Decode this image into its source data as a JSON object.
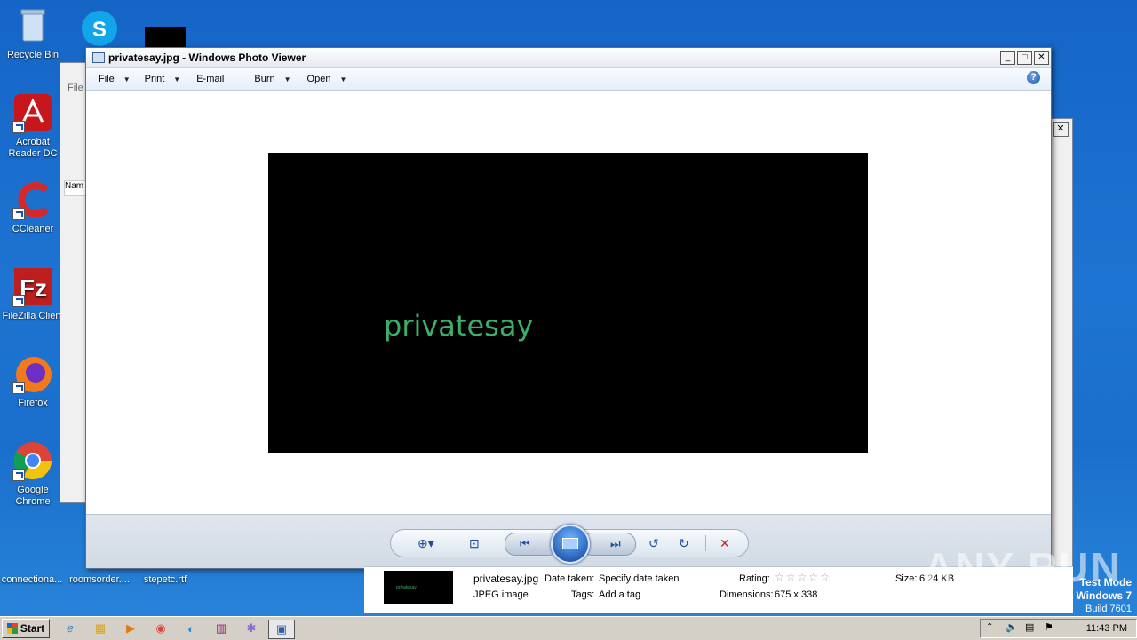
{
  "desktop": {
    "icons": [
      {
        "label": "Recycle Bin",
        "icon": "recycle-bin-icon"
      },
      {
        "label": "Acrobat Reader DC",
        "icon": "acrobat-icon"
      },
      {
        "label": "CCleaner",
        "icon": "ccleaner-icon"
      },
      {
        "label": "FileZilla Client",
        "icon": "filezilla-icon"
      },
      {
        "label": "Firefox",
        "icon": "firefox-icon"
      },
      {
        "label": "Google Chrome",
        "icon": "chrome-icon"
      }
    ],
    "files": [
      "connectiona...",
      "roomsorder....",
      "stepetc.rtf"
    ]
  },
  "viewer": {
    "title": "privatesay.jpg - Windows Photo Viewer",
    "menu": [
      {
        "label": "File",
        "caret": "▼"
      },
      {
        "label": "Print",
        "caret": "▼"
      },
      {
        "label": "E-mail",
        "caret": ""
      },
      {
        "label": "Burn",
        "caret": "▼"
      },
      {
        "label": "Open",
        "caret": "▼"
      }
    ],
    "help": "?",
    "photo_text": "privatesay"
  },
  "details": {
    "filename": "privatesay.jpg",
    "filetype": "JPEG image",
    "date_label": "Date taken:",
    "date_value": "Specify date taken",
    "tags_label": "Tags:",
    "tags_value": "Add a tag",
    "rating_label": "Rating:",
    "dimensions_label": "Dimensions:",
    "dimensions_value": "675 x 338",
    "size_label": "Size:",
    "size_value": "6.24 KB",
    "thumb_text": "privatesay"
  },
  "taskbar": {
    "start": "Start",
    "time": "11:43 PM"
  },
  "system": {
    "test_mode": "Test Mode",
    "os": "Windows 7",
    "build": "Build 7601",
    "watermark": "ANY RUN"
  },
  "colors": {
    "desktop": "#1a6fcc",
    "photo_text": "#3cae6a",
    "close_x": "#d22020"
  }
}
